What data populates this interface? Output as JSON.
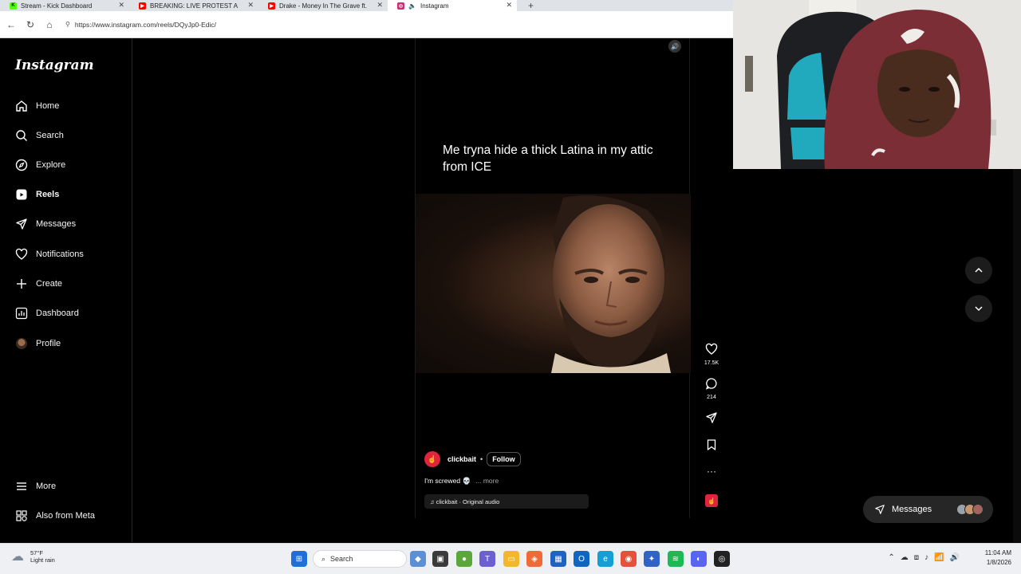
{
  "browser": {
    "tabs": [
      {
        "title": "Stream - Kick Dashboard",
        "fav_color": "#53fc18",
        "fav_letter": "K"
      },
      {
        "title": "BREAKING: LIVE PROTEST AFT",
        "fav_color": "#ff0000",
        "fav_letter": "▶"
      },
      {
        "title": "Drake - Money In The Grave ft. Ri",
        "fav_color": "#ff0000",
        "fav_letter": "▶"
      },
      {
        "title": "Instagram",
        "fav_color": "#d62976",
        "fav_letter": "◎"
      }
    ],
    "url": "https://www.instagram.com/reels/DQyJp0-Edic/"
  },
  "instagram": {
    "logo": "Instagram",
    "nav": [
      {
        "label": "Home",
        "icon": "home-icon"
      },
      {
        "label": "Search",
        "icon": "search-icon"
      },
      {
        "label": "Explore",
        "icon": "compass-icon"
      },
      {
        "label": "Reels",
        "icon": "reels-icon"
      },
      {
        "label": "Messages",
        "icon": "paper-plane-icon"
      },
      {
        "label": "Notifications",
        "icon": "heart-icon"
      },
      {
        "label": "Create",
        "icon": "plus-icon"
      },
      {
        "label": "Dashboard",
        "icon": "chart-icon"
      },
      {
        "label": "Profile",
        "icon": "avatar"
      }
    ],
    "bottom_nav": [
      {
        "label": "More",
        "icon": "menu-icon"
      },
      {
        "label": "Also from Meta",
        "icon": "meta-icon"
      }
    ]
  },
  "reel": {
    "overlay_text": "Me tryna hide a thick Latina in my attic from ICE",
    "author": "clickbait",
    "follow_label": "Follow",
    "description": "I'm screwed 💀",
    "more_label": "... more",
    "audio": "♫ clickbait · Original audio",
    "likes": "17.5K",
    "comments": "214"
  },
  "messages_pill": {
    "label": "Messages"
  },
  "taskbar": {
    "temp": "57°F",
    "condition": "Light rain",
    "search_placeholder": "Search",
    "time": "11:04 AM",
    "date": "1/8/2026"
  }
}
